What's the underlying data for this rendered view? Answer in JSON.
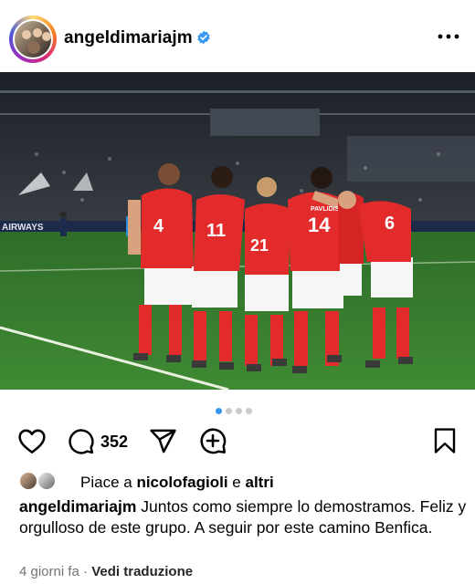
{
  "post": {
    "username": "angeldimariajm",
    "verified": true,
    "comments_count": "352",
    "carousel": {
      "total": 4,
      "active": 1
    },
    "likes": {
      "prefix": "Piace a",
      "user": "nicolofagioli",
      "conjunction": "e",
      "others": "altri"
    },
    "caption": "Juntos como siempre lo demostramos. Feliz y orgulloso de este grupo. A seguir por este camino Benfica.",
    "time_ago": "4 giorni fa",
    "separator": "·",
    "translate_label": "Vedi traduzione"
  },
  "photo": {
    "ad_board_text": "AIRWAYS",
    "players": [
      {
        "number": "4"
      },
      {
        "number": "11"
      },
      {
        "number": "21"
      },
      {
        "number": "14",
        "name": "PAVLIDIS"
      },
      {
        "number": "6"
      }
    ]
  },
  "colors": {
    "accent": "#3897f0",
    "verified": "#3897f0",
    "kit_red": "#e32b2b"
  },
  "icons": [
    "more-options-icon",
    "heart-icon",
    "comment-icon",
    "share-icon",
    "remix-icon",
    "bookmark-icon",
    "verified-badge-icon"
  ]
}
